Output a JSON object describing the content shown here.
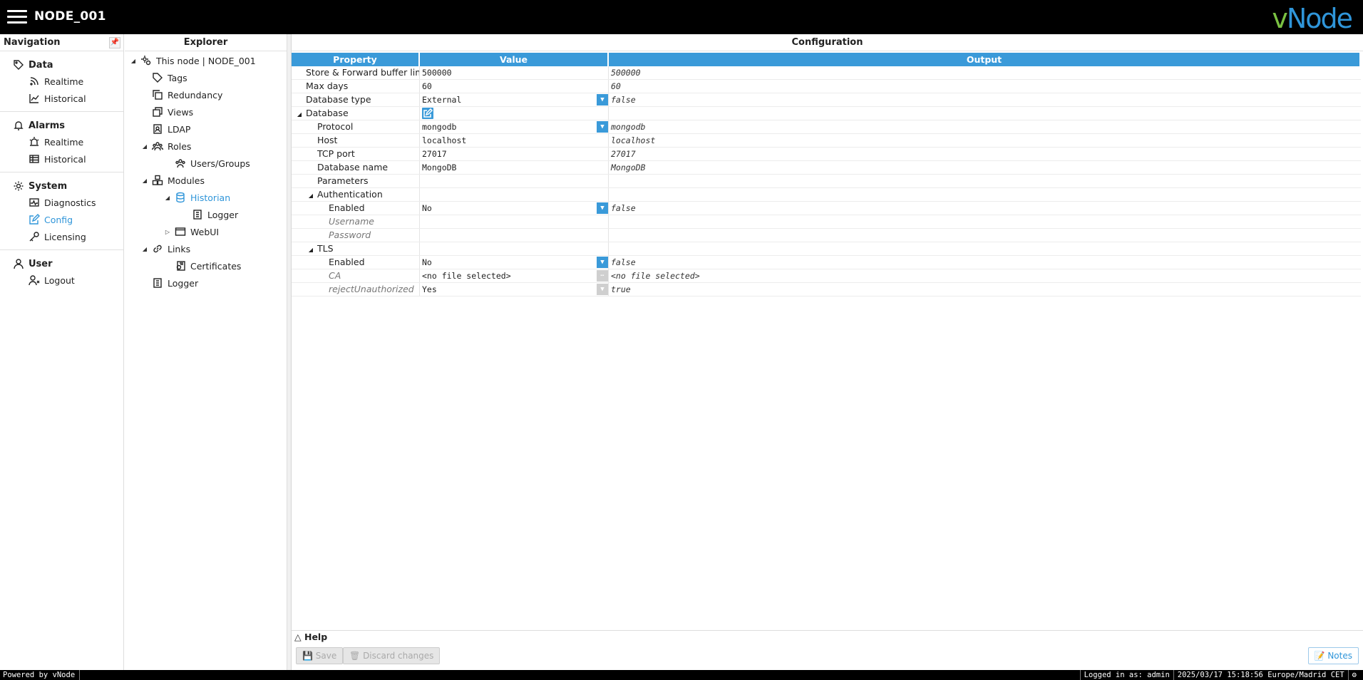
{
  "header": {
    "node_title": "NODE_001",
    "logo_v": "v",
    "logo_node": "Node"
  },
  "navigation": {
    "title": "Navigation",
    "sections": [
      {
        "label": "Data",
        "items": [
          "Realtime",
          "Historical"
        ]
      },
      {
        "label": "Alarms",
        "items": [
          "Realtime",
          "Historical"
        ]
      },
      {
        "label": "System",
        "items": [
          "Diagnostics",
          "Config",
          "Licensing"
        ]
      },
      {
        "label": "User",
        "items": [
          "Logout"
        ]
      }
    ]
  },
  "explorer": {
    "title": "Explorer",
    "items": [
      "This node | NODE_001",
      "Tags",
      "Redundancy",
      "Views",
      "LDAP",
      "Roles",
      "Users/Groups",
      "Modules",
      "Historian",
      "Logger",
      "WebUI",
      "Links",
      "Certificates",
      "Logger"
    ]
  },
  "config": {
    "title": "Configuration",
    "headers": {
      "property": "Property",
      "value": "Value",
      "output": "Output"
    },
    "rows": [
      {
        "property": "Store & Forward buffer limit",
        "value": "500000",
        "output": "500000"
      },
      {
        "property": "Max days",
        "value": "60",
        "output": "60"
      },
      {
        "property": "Database type",
        "value": "External",
        "output": "false"
      },
      {
        "property": "Database",
        "value": "",
        "output": ""
      },
      {
        "property": "Protocol",
        "value": "mongodb",
        "output": "mongodb"
      },
      {
        "property": "Host",
        "value": "localhost",
        "output": "localhost"
      },
      {
        "property": "TCP port",
        "value": "27017",
        "output": "27017"
      },
      {
        "property": "Database name",
        "value": "MongoDB",
        "output": "MongoDB"
      },
      {
        "property": "Parameters",
        "value": "",
        "output": ""
      },
      {
        "property": "Authentication",
        "value": "",
        "output": ""
      },
      {
        "property": "Enabled",
        "value": "No",
        "output": "false"
      },
      {
        "property": "Username",
        "value": "",
        "output": ""
      },
      {
        "property": "Password",
        "value": "",
        "output": ""
      },
      {
        "property": "TLS",
        "value": "",
        "output": ""
      },
      {
        "property": "Enabled",
        "value": "No",
        "output": "false"
      },
      {
        "property": "CA",
        "value": "<no file selected>",
        "output": "<no file selected>"
      },
      {
        "property": "rejectUnauthorized",
        "value": "Yes",
        "output": "true"
      }
    ]
  },
  "help": {
    "label": "Help"
  },
  "buttons": {
    "save": "Save",
    "discard": "Discard changes",
    "notes": "Notes"
  },
  "status": {
    "powered_by": "Powered by vNode",
    "logged_in": "Logged in as: admin",
    "datetime": "2025/03/17 15:18:56 Europe/Madrid CET"
  },
  "colors": {
    "accent": "#3a9ad9",
    "logo_green": "#7ac142",
    "topbar": "#000000"
  }
}
